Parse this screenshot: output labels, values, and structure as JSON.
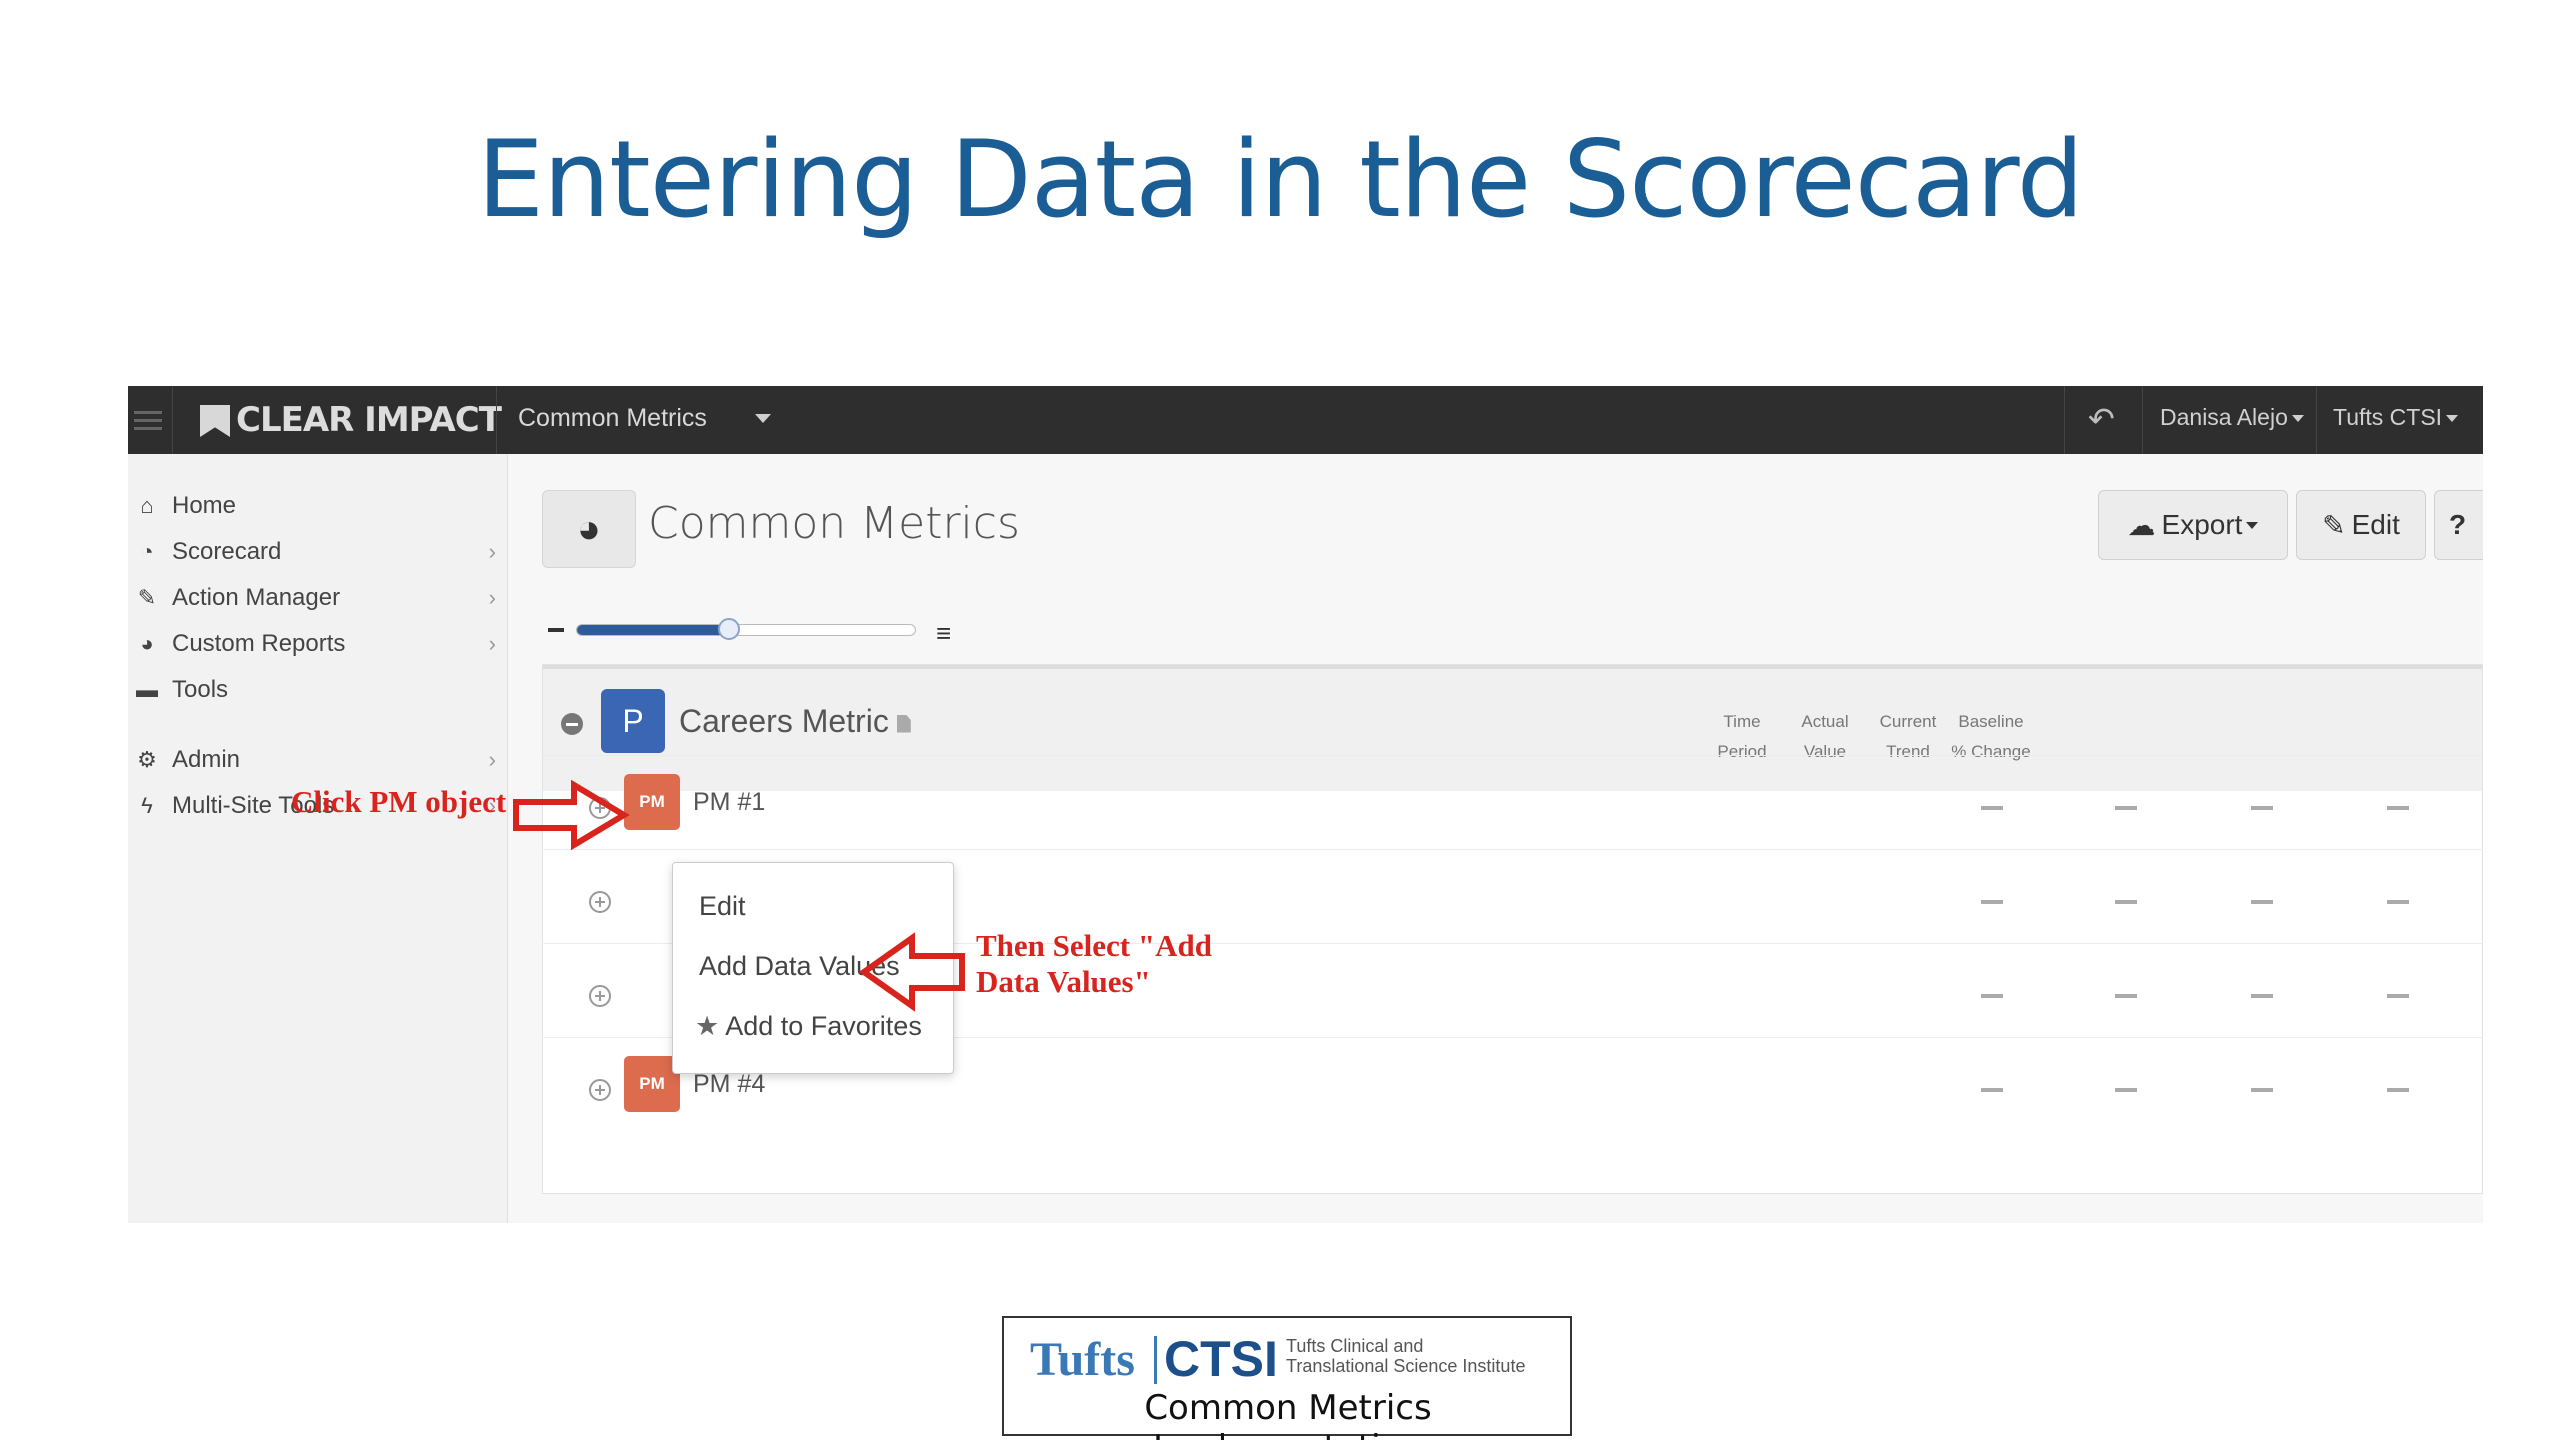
{
  "slide": {
    "title": "Entering Data in the Scorecard"
  },
  "app": {
    "brand": "CLEAR IMPACT",
    "site": "Common Metrics",
    "user": "Danisa Alejo",
    "org": "Tufts CTSI",
    "sidebar": [
      {
        "label": "Home",
        "icon": "home-icon",
        "glyph": "⌂"
      },
      {
        "label": "Scorecard",
        "icon": "dashboard-icon",
        "glyph": "◔"
      },
      {
        "label": "Action Manager",
        "icon": "wrench-icon",
        "glyph": "✎"
      },
      {
        "label": "Custom Reports",
        "icon": "pie-chart-icon",
        "glyph": "◕"
      },
      {
        "label": "Tools",
        "icon": "toolbox-icon",
        "glyph": "▬"
      },
      {
        "label": "Admin",
        "icon": "gears-icon",
        "glyph": "⚙"
      },
      {
        "label": "Multi-Site Tools",
        "icon": "bolt-icon",
        "glyph": "ϟ"
      }
    ],
    "page_title": "Common Metrics",
    "buttons": {
      "export": "Export",
      "edit": "Edit",
      "help": "?"
    },
    "zoom_level": 0.45,
    "program": {
      "badge": "P",
      "title": "Careers Metric"
    },
    "columns": [
      {
        "l1": "Time",
        "l2": "Period"
      },
      {
        "l1": "Actual",
        "l2": "Value"
      },
      {
        "l1": "Current",
        "l2": "Trend"
      },
      {
        "l1": "Baseline",
        "l2": "% Change"
      }
    ],
    "rows": [
      {
        "badge": "PM",
        "label": "PM #1"
      },
      {
        "badge": "",
        "label": ""
      },
      {
        "badge": "",
        "label": ""
      },
      {
        "badge": "PM",
        "label": "PM #4"
      }
    ],
    "context_menu": {
      "edit": "Edit",
      "add_data": "Add Data Values",
      "favorites": "Add to Favorites"
    }
  },
  "annotations": {
    "click": "Click PM object",
    "select_line1": "Then Select \"Add",
    "select_line2": "Data Values\""
  },
  "logo": {
    "tufts": "Tufts",
    "ctsi": "CTSI",
    "institute_line1": "Tufts Clinical and",
    "institute_line2": "Translational Science Institute",
    "subtitle": "Common Metrics Implementation"
  },
  "colors": {
    "title": "#1b5e95",
    "annotation": "#d9231d",
    "program_badge": "#3b66b3",
    "pm_badge": "#dd6b4d"
  }
}
